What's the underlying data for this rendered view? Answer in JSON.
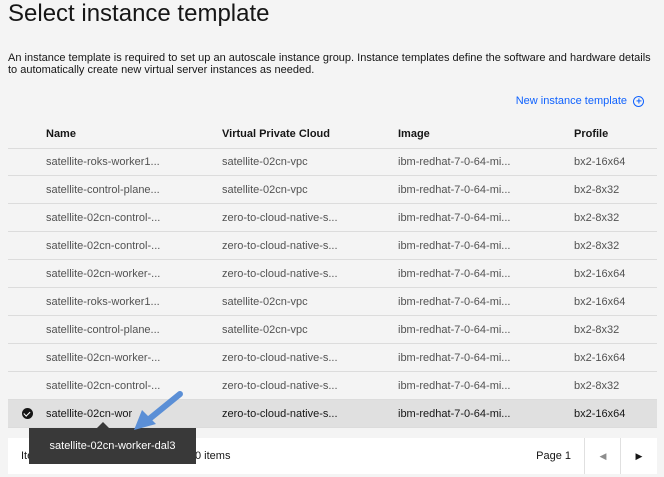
{
  "page": {
    "title": "Select instance template",
    "description": "An instance template is required to set up an autoscale instance group. Instance templates define the software and hardware details to automatically create new virtual server instances as needed.",
    "new_template_label": "New instance template"
  },
  "table": {
    "headers": [
      "Name",
      "Virtual Private Cloud",
      "Image",
      "Profile"
    ],
    "rows": [
      {
        "name": "satellite-roks-worker1...",
        "vpc": "satellite-02cn-vpc",
        "image": "ibm-redhat-7-0-64-mi...",
        "profile": "bx2-16x64"
      },
      {
        "name": "satellite-control-plane...",
        "vpc": "satellite-02cn-vpc",
        "image": "ibm-redhat-7-0-64-mi...",
        "profile": "bx2-8x32"
      },
      {
        "name": "satellite-02cn-control-...",
        "vpc": "zero-to-cloud-native-s...",
        "image": "ibm-redhat-7-0-64-mi...",
        "profile": "bx2-8x32"
      },
      {
        "name": "satellite-02cn-control-...",
        "vpc": "zero-to-cloud-native-s...",
        "image": "ibm-redhat-7-0-64-mi...",
        "profile": "bx2-8x32"
      },
      {
        "name": "satellite-02cn-worker-...",
        "vpc": "zero-to-cloud-native-s...",
        "image": "ibm-redhat-7-0-64-mi...",
        "profile": "bx2-16x64"
      },
      {
        "name": "satellite-roks-worker1...",
        "vpc": "satellite-02cn-vpc",
        "image": "ibm-redhat-7-0-64-mi...",
        "profile": "bx2-16x64"
      },
      {
        "name": "satellite-control-plane...",
        "vpc": "satellite-02cn-vpc",
        "image": "ibm-redhat-7-0-64-mi...",
        "profile": "bx2-8x32"
      },
      {
        "name": "satellite-02cn-worker-...",
        "vpc": "zero-to-cloud-native-s...",
        "image": "ibm-redhat-7-0-64-mi...",
        "profile": "bx2-16x64"
      },
      {
        "name": "satellite-02cn-control-...",
        "vpc": "zero-to-cloud-native-s...",
        "image": "ibm-redhat-7-0-64-mi...",
        "profile": "bx2-8x32"
      },
      {
        "name": "satellite-02cn-wor",
        "vpc": "zero-to-cloud-native-s...",
        "image": "ibm-redhat-7-0-64-mi...",
        "profile": "bx2-16x64",
        "selected": true
      }
    ]
  },
  "pagination": {
    "items_label": "Ite",
    "count_label": "0 items",
    "page_label": "Page 1",
    "prev_icon": "caret-left-icon",
    "next_icon": "caret-right-icon"
  },
  "tooltip": {
    "text": "satellite-02cn-worker-dal3"
  },
  "colors": {
    "accent": "#0f62fe",
    "annotation_arrow": "#5b8fd6",
    "tooltip_bg": "#393939",
    "selected_row": "#e0e0e0"
  }
}
